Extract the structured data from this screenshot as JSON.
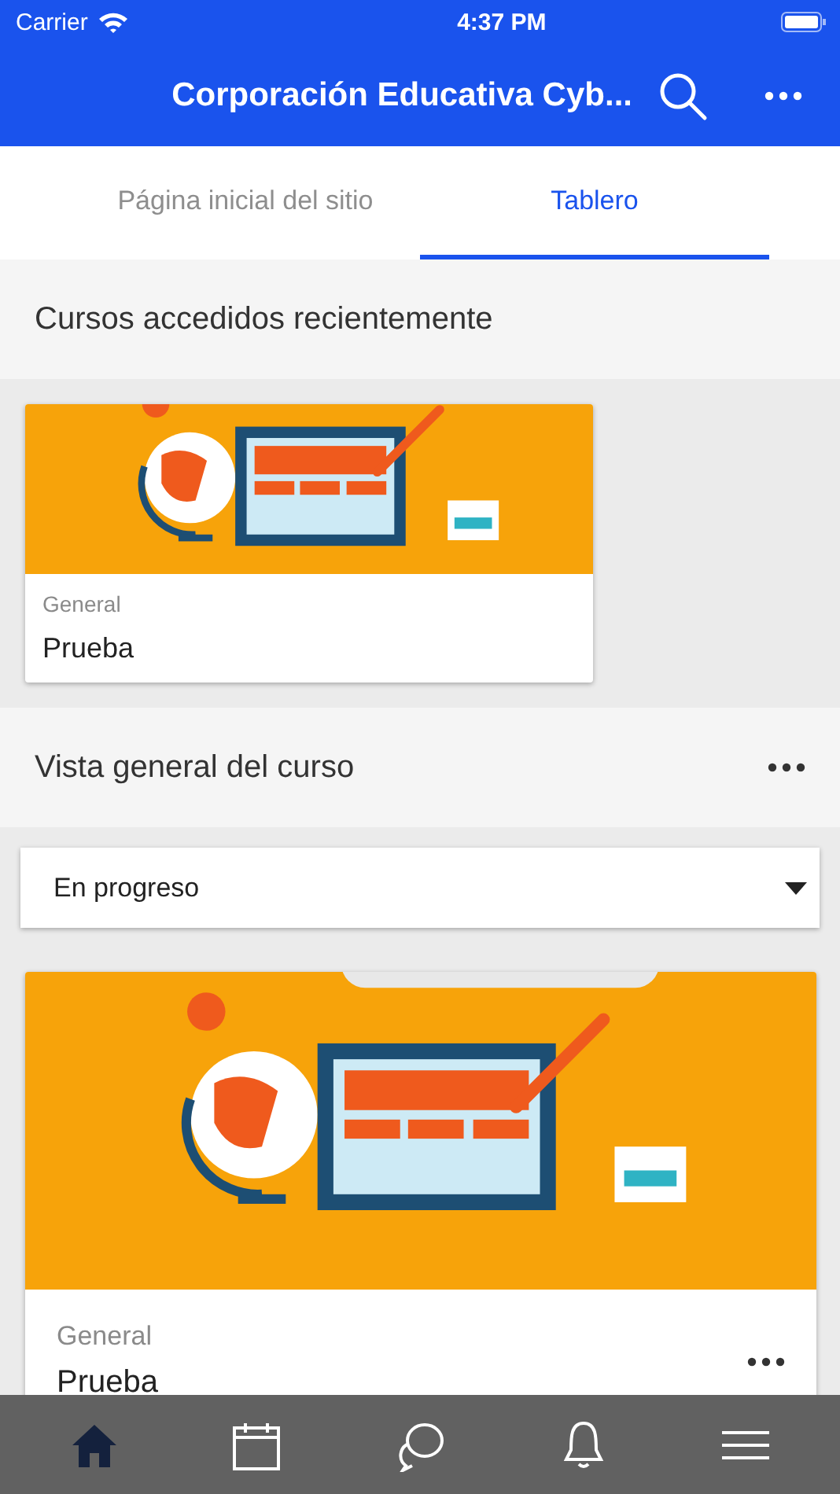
{
  "status_bar": {
    "carrier": "Carrier",
    "time": "4:37 PM"
  },
  "nav": {
    "title": "Corporación Educativa Cyb..."
  },
  "tabs": [
    {
      "label": "Página inicial del sitio",
      "selected": false
    },
    {
      "label": "Tablero",
      "selected": true
    }
  ],
  "recent": {
    "title": "Cursos accedidos recientemente",
    "courses": [
      {
        "category": "General",
        "name": "Prueba"
      }
    ]
  },
  "overview": {
    "title": "Vista general del curso",
    "filter": "En progreso",
    "courses": [
      {
        "category": "General",
        "name": "Prueba"
      }
    ]
  },
  "bottom_tabs": [
    {
      "kind": "home",
      "selected": true
    },
    {
      "kind": "calendar",
      "selected": false
    },
    {
      "kind": "messages",
      "selected": false
    },
    {
      "kind": "notifications",
      "selected": false
    },
    {
      "kind": "menu",
      "selected": false
    }
  ]
}
